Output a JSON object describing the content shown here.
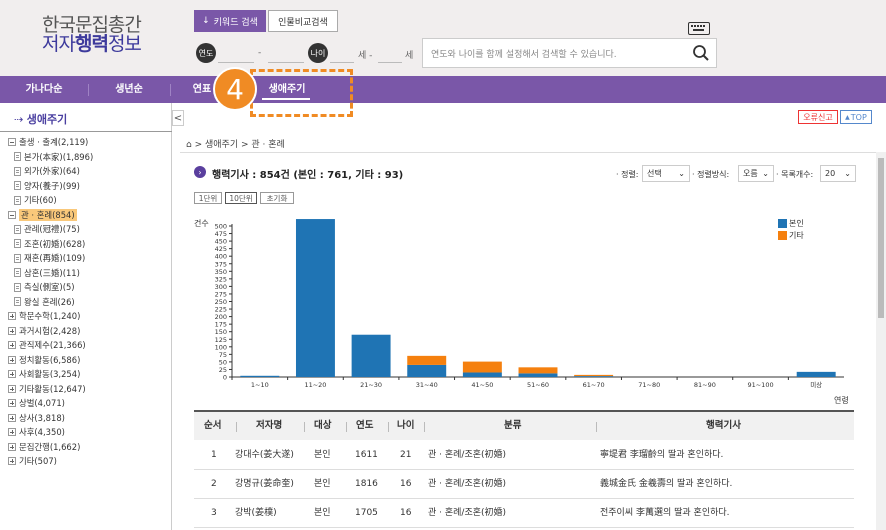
{
  "header": {
    "logo_line1": "한국문집총간",
    "logo_line2_a": "저자",
    "logo_line2_b": "행력",
    "logo_line2_c": "정보",
    "tab_keyword": "키워드 검색",
    "tab_compare": "인물비교검색",
    "year_label": "연도",
    "age_label": "나이",
    "year_dash": "-",
    "age_unit1": "세 -",
    "age_unit2": "세",
    "search_placeholder": "연도와 나이를 함께 설정해서 검색할 수 있습니다."
  },
  "nav": {
    "items": [
      "가나다순",
      "생년순",
      "연표",
      "생애주기"
    ],
    "active": "생애주기",
    "badge": "4"
  },
  "sidebar": {
    "title": "생애주기",
    "tree": [
      {
        "label": "출생 · 출계(2,119)",
        "type": "minus",
        "level": 0
      },
      {
        "label": "본가(本家)(1,896)",
        "type": "doc",
        "level": 1
      },
      {
        "label": "외가(外家)(64)",
        "type": "doc",
        "level": 1
      },
      {
        "label": "양자(養子)(99)",
        "type": "doc",
        "level": 1
      },
      {
        "label": "기타(60)",
        "type": "doc",
        "level": 1
      },
      {
        "label": "관 · 혼례(854)",
        "type": "minus",
        "level": 0,
        "hl": true
      },
      {
        "label": "관례(冠禮)(75)",
        "type": "doc",
        "level": 1
      },
      {
        "label": "조혼(初婚)(628)",
        "type": "doc",
        "level": 1
      },
      {
        "label": "재혼(再婚)(109)",
        "type": "doc",
        "level": 1
      },
      {
        "label": "삼혼(三婚)(11)",
        "type": "doc",
        "level": 1
      },
      {
        "label": "측실(側室)(5)",
        "type": "doc",
        "level": 1
      },
      {
        "label": "왕실 혼례(26)",
        "type": "doc",
        "level": 1
      },
      {
        "label": "학문수학(1,240)",
        "type": "plus",
        "level": 0
      },
      {
        "label": "과거시험(2,428)",
        "type": "plus",
        "level": 0
      },
      {
        "label": "관직제수(21,366)",
        "type": "plus",
        "level": 0
      },
      {
        "label": "정치활동(6,586)",
        "type": "plus",
        "level": 0
      },
      {
        "label": "사회활동(3,254)",
        "type": "plus",
        "level": 0
      },
      {
        "label": "기타활동(12,647)",
        "type": "plus",
        "level": 0
      },
      {
        "label": "상벌(4,071)",
        "type": "plus",
        "level": 0
      },
      {
        "label": "상사(3,818)",
        "type": "plus",
        "level": 0
      },
      {
        "label": "사후(4,350)",
        "type": "plus",
        "level": 0
      },
      {
        "label": "문집간행(1,662)",
        "type": "plus",
        "level": 0
      },
      {
        "label": "기타(507)",
        "type": "plus",
        "level": 0
      }
    ]
  },
  "toolbar": {
    "error_report": "오류신고",
    "top": "TOP",
    "collapse": "<"
  },
  "breadcrumb": "> 생애주기 > 관 · 혼례",
  "content": {
    "count_title": "행력기사 : 854건 (본인 : 761, 기타 : 93)",
    "sort_label": "· 정렬:",
    "sort_value": "선택",
    "sortdir_label": "· 정렬방식:",
    "sortdir_value": "오름",
    "perpage_label": "· 목록개수:",
    "perpage_value": "20",
    "units": [
      "1단위",
      "10단위",
      "초기화"
    ]
  },
  "chart_data": {
    "type": "bar",
    "stacked": true,
    "categories": [
      "1~10",
      "11~20",
      "21~30",
      "31~40",
      "41~50",
      "51~60",
      "61~70",
      "71~80",
      "81~90",
      "91~100",
      "미상"
    ],
    "series": [
      {
        "name": "본인",
        "color": "#1f74b4",
        "values": [
          4,
          523,
          140,
          40,
          15,
          12,
          3,
          0,
          0,
          0,
          17
        ]
      },
      {
        "name": "기타",
        "color": "#f5800e",
        "values": [
          0,
          0,
          0,
          30,
          36,
          20,
          4,
          0,
          0,
          0,
          0
        ]
      }
    ],
    "ylabel": "건수",
    "xlabel": "연령",
    "ylim": [
      0,
      500
    ],
    "yticks": [
      0,
      25,
      50,
      75,
      100,
      125,
      150,
      175,
      200,
      225,
      250,
      275,
      300,
      325,
      350,
      375,
      400,
      425,
      450,
      475,
      500
    ],
    "legend": "top-right"
  },
  "table": {
    "headers": [
      "순서",
      "저자명",
      "대상",
      "연도",
      "나이",
      "분류",
      "행력기사"
    ],
    "rows": [
      [
        "1",
        "강대수(姜大遂)",
        "본인",
        "1611",
        "21",
        "관 · 혼례/조혼(初婚)",
        "寧堤君 李瑠齡의 딸과 혼인하다."
      ],
      [
        "2",
        "강명규(姜命奎)",
        "본인",
        "1816",
        "16",
        "관 · 혼례/조혼(初婚)",
        "義城金氏 金羲壽의 딸과 혼인하다."
      ],
      [
        "3",
        "강박(姜樸)",
        "본인",
        "1705",
        "16",
        "관 · 혼례/조혼(初婚)",
        "전주이씨 李萬選의 딸과 혼인하다."
      ]
    ]
  }
}
